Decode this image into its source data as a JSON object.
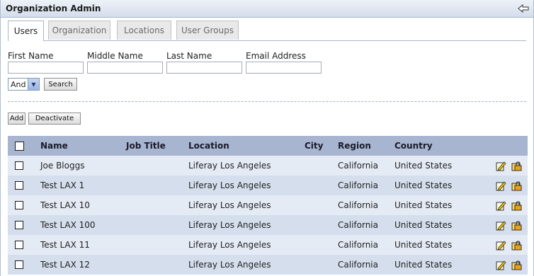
{
  "portlet": {
    "title": "Organization Admin"
  },
  "tabs": [
    "Users",
    "Organization",
    "Locations",
    "User Groups"
  ],
  "search": {
    "fields": [
      {
        "label": "First Name",
        "value": ""
      },
      {
        "label": "Middle Name",
        "value": ""
      },
      {
        "label": "Last Name",
        "value": ""
      },
      {
        "label": "Email Address",
        "value": ""
      }
    ],
    "operator": "And",
    "search_label": "Search"
  },
  "actions": {
    "add_label": "Add",
    "deactivate_label": "Deactivate"
  },
  "table": {
    "columns": [
      "Name",
      "Job Title",
      "Location",
      "City",
      "Region",
      "Country"
    ],
    "rows": [
      {
        "name": "Joe Bloggs",
        "job_title": "",
        "location": "Liferay Los Angeles",
        "city": "",
        "region": "California",
        "country": "United States"
      },
      {
        "name": "Test LAX 1",
        "job_title": "",
        "location": "Liferay Los Angeles",
        "city": "",
        "region": "California",
        "country": "United States"
      },
      {
        "name": "Test LAX 10",
        "job_title": "",
        "location": "Liferay Los Angeles",
        "city": "",
        "region": "California",
        "country": "United States"
      },
      {
        "name": "Test LAX 100",
        "job_title": "",
        "location": "Liferay Los Angeles",
        "city": "",
        "region": "California",
        "country": "United States"
      },
      {
        "name": "Test LAX 11",
        "job_title": "",
        "location": "Liferay Los Angeles",
        "city": "",
        "region": "California",
        "country": "United States"
      },
      {
        "name": "Test LAX 12",
        "job_title": "",
        "location": "Liferay Los Angeles",
        "city": "",
        "region": "California",
        "country": "United States"
      }
    ],
    "row_icons": [
      "edit-icon",
      "permissions-icon"
    ]
  },
  "colors": {
    "header_bg": "#a7b5d1",
    "row_odd": "#e5ebf5",
    "row_even": "#d4deed",
    "title_bar": "#d4dded"
  }
}
